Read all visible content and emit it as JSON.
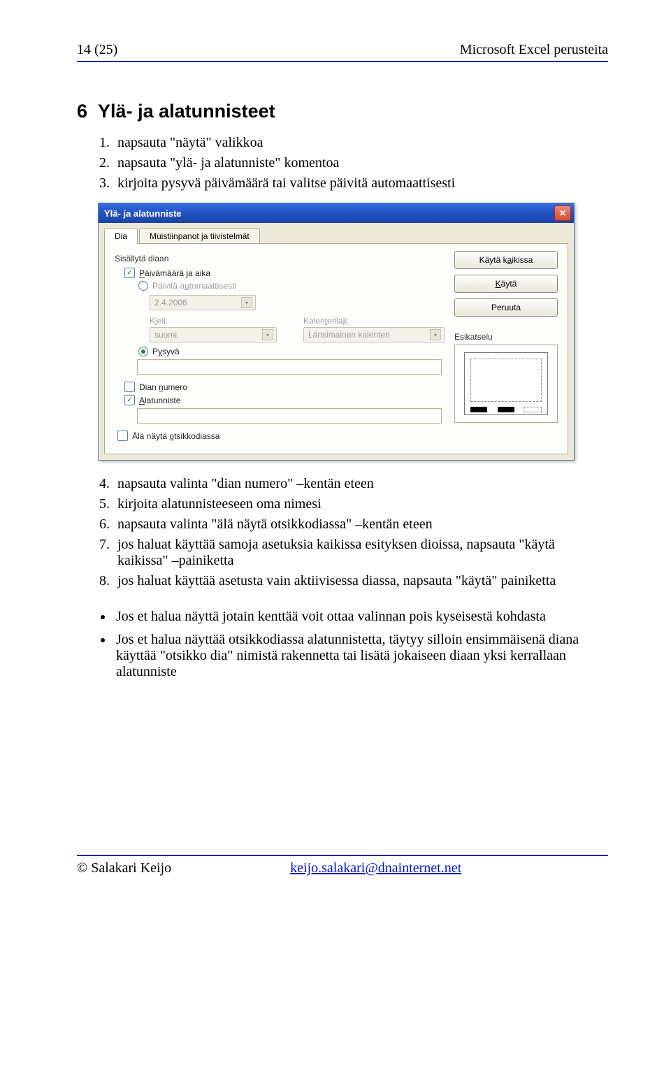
{
  "header": {
    "page": "14 (25)",
    "doc_title": "Microsoft Excel perusteita"
  },
  "section": {
    "number": "6",
    "title": "Ylä- ja alatunnisteet"
  },
  "steps_before": [
    "napsauta \"näytä\" valikkoa",
    "napsauta \"ylä- ja alatunniste\" komentoa",
    "kirjoita pysyvä päivämäärä tai valitse päivitä automaattisesti"
  ],
  "dialog": {
    "title": "Ylä- ja alatunniste",
    "close_label": "✕",
    "tabs": {
      "active": "Dia",
      "secondary": "Muistiinpanot ja tiivistelmät"
    },
    "buttons": {
      "apply_all": "Käytä kaikissa",
      "apply": "Käytä",
      "cancel": "Peruuta"
    },
    "group_label": "Sisällytä diaan",
    "opts": {
      "datetime": "Päivämäärä ja aika",
      "auto_update": "Päivitä automaattisesti",
      "date_value": "2.4.2006",
      "lang_label": "Kieli:",
      "lang_value": "suomi",
      "cal_label": "Kalenterilaji:",
      "cal_value": "Länsimainen kalenteri",
      "fixed": "Pysyvä",
      "slide_number": "Dian numero",
      "footer": "Alatunniste",
      "dont_show_title": "Älä näytä otsikkodiassa"
    },
    "preview_label": "Esikatselu"
  },
  "steps_after": [
    "napsauta valinta \"dian numero\" –kentän eteen",
    "kirjoita alatunnisteeseen oma nimesi",
    "napsauta valinta \"älä näytä otsikkodiassa\" –kentän eteen",
    "jos haluat käyttää samoja asetuksia kaikissa esityksen dioissa, napsauta \"käytä kaikissa\" –painiketta",
    "jos haluat käyttää asetusta vain aktiivisessa diassa, napsauta \"käytä\" painiketta"
  ],
  "bullets": [
    "Jos et halua näyttä jotain kenttää voit ottaa valinnan pois kyseisestä kohdasta",
    "Jos et halua näyttää otsikkodiassa alatunnistetta, täytyy silloin ensimmäisenä diana käyttää \"otsikko dia\" nimistä rakennetta tai lisätä jokaiseen diaan yksi kerrallaan alatunniste"
  ],
  "footer": {
    "author": "© Salakari Keijo",
    "email": "keijo.salakari@dnainternet.net"
  }
}
